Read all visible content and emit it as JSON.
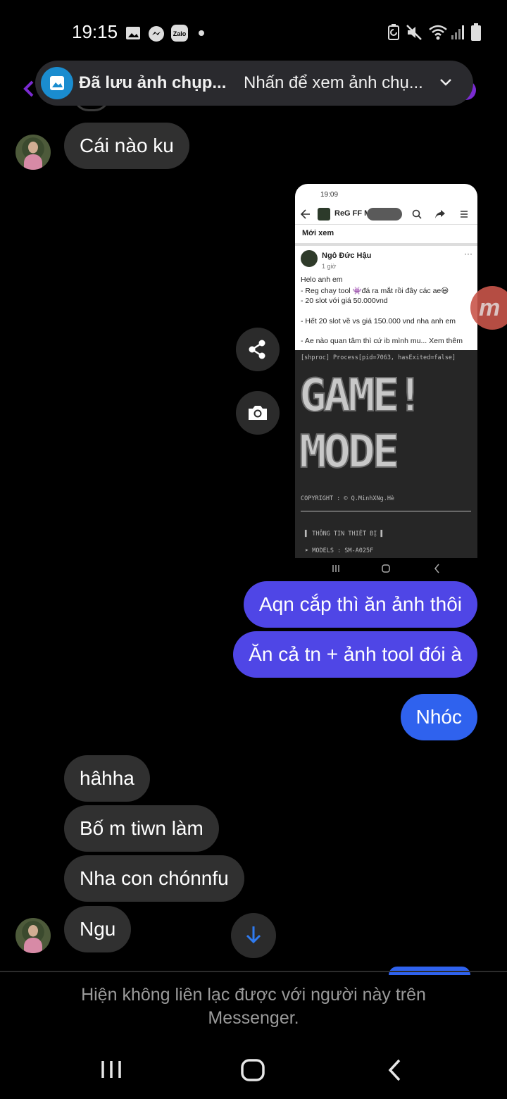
{
  "status_bar": {
    "time": "19:15",
    "app_icons": [
      "gallery-icon",
      "messenger-icon",
      "zalo-icon"
    ],
    "zalo_label": "Zalo",
    "right_icons": [
      "battery-saver-icon",
      "mute-icon",
      "wifi-icon",
      "signal-icon",
      "battery-icon"
    ]
  },
  "notification": {
    "title": "Đã lưu ảnh chụp...",
    "message": "Nhấn để xem ảnh chụ..."
  },
  "messages": [
    {
      "id": "m1",
      "side": "incoming",
      "text": "Cái nào ku",
      "has_avatar": true
    },
    {
      "id": "m2",
      "side": "incoming",
      "type": "image"
    },
    {
      "id": "m3",
      "side": "outgoing",
      "text": "Aqn cắp thì ăn ảnh thôi"
    },
    {
      "id": "m4",
      "side": "outgoing",
      "text": "Ăn cả tn + ảnh tool đói à"
    },
    {
      "id": "m5",
      "side": "outgoing",
      "text": "Nhóc"
    },
    {
      "id": "m6",
      "side": "incoming",
      "text": "hâhha"
    },
    {
      "id": "m7",
      "side": "incoming",
      "text": "Bố m tiwn làm"
    },
    {
      "id": "m8",
      "side": "incoming",
      "text": "Nha con chónnfu"
    },
    {
      "id": "m9",
      "side": "incoming",
      "text": "Ngu",
      "has_avatar": true
    }
  ],
  "shared_image": {
    "status_time": "19:09",
    "page_title": "ReG FF Mi... Thủ...",
    "section": "Mới xem",
    "post_author": "Ngô Đức Hậu",
    "post_time": "1 giờ",
    "post_lines": [
      "Helo anh em",
      "- Reg chay tool 👾đá ra mắt rồi đây các ae😆",
      "- 20 slot với giá 50.000vnd",
      "",
      "- Hết 20 slot về vs giá 150.000 vnd nha anh em",
      "",
      "- Ae nào quan tâm thì cứ ib mình mu... Xem thêm"
    ],
    "terminal_lines": [
      "[shproc] Process[pid=7063, hasExited=false]",
      "COPYRIGHT : © Q.MinhXNg.Hè",
      "▌ THÔNG TIN THIẾT BỊ ▌",
      "➤ MODELS : SM-A025F"
    ],
    "ascii_art": [
      "GAME!",
      "MODE"
    ]
  },
  "floating_buttons": [
    "share-icon",
    "camera-icon"
  ],
  "edge_logo": "m",
  "bottom_notice": "Hiện không liên lạc được với người này trên Messenger.",
  "nav_bar": [
    "recents-icon",
    "home-icon",
    "back-icon"
  ]
}
